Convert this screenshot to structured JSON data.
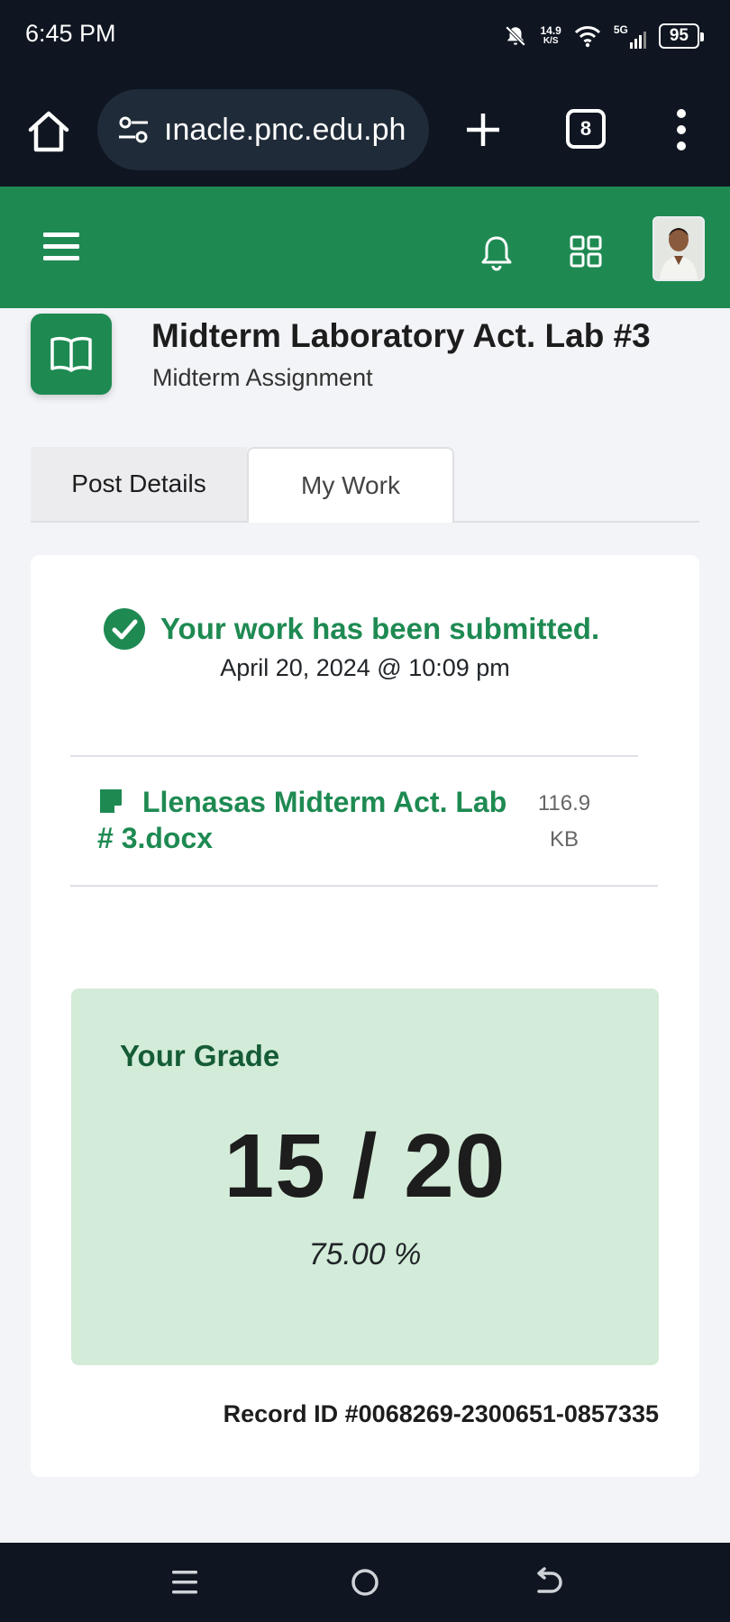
{
  "status_bar": {
    "time": "6:45 PM",
    "net_speed_value": "14.9",
    "net_speed_unit": "K/S",
    "network": "5G",
    "battery": "95"
  },
  "browser": {
    "url": "ınacle.pnc.edu.ph",
    "tab_count": "8"
  },
  "app_header": {
    "icons": [
      "hamburger-menu-icon",
      "notification-bell-icon",
      "apps-grid-icon",
      "user-avatar"
    ],
    "color": "#1e8a52"
  },
  "page": {
    "title": "Midterm Laboratory Act. Lab #3",
    "subtitle": "Midterm Assignment"
  },
  "tabs": [
    {
      "label": "Post Details",
      "active": false
    },
    {
      "label": "My Work",
      "active": true
    }
  ],
  "submission": {
    "status": "Your work has been submitted.",
    "date": "April 20, 2024 @ 10:09 pm",
    "file_name": "Llenasas Midterm Act. Lab # 3.docx",
    "file_size": "116.9 KB"
  },
  "grade": {
    "label": "Your Grade",
    "score": "15 / 20",
    "percent": "75.00 %"
  },
  "record_id": "Record ID #0068269-2300651-0857335",
  "colors": {
    "brand_green": "#1e8a52",
    "grade_bg": "#d3ecd9",
    "dark_bar": "#0f1621"
  }
}
